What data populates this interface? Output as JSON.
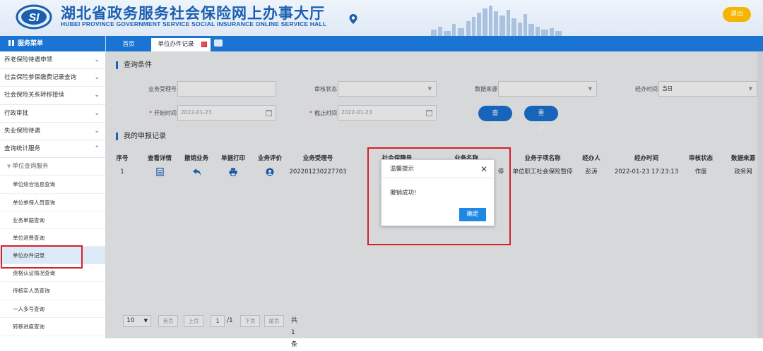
{
  "header": {
    "title_cn": "湖北省政务服务社会保险网上办事大厅",
    "title_en": "HUBEI PROVINCE GOVERNMENT SERVICE SOCIAL INSURANCE ONLINE SERVICE HALL",
    "logout": "退出"
  },
  "sidebar": {
    "heading": "服务菜单",
    "items": [
      {
        "label": "养老保险待遇申领",
        "chev": "⌄"
      },
      {
        "label": "社会保险参保缴费记录查询",
        "chev": "⌄"
      },
      {
        "label": "社会保险关系转移接续",
        "chev": "⌄"
      },
      {
        "label": "行政审批",
        "chev": "⌄"
      },
      {
        "label": "失业保险待遇",
        "chev": "⌄"
      },
      {
        "label": "查询统计服务",
        "chev": "⌃"
      }
    ],
    "sub_group": "单位查询服务",
    "leaves": [
      "单位综合信息查询",
      "单位参保人员查询",
      "业务单据查询",
      "单位退费查询",
      "单位办件记录",
      "资格认证情况查询",
      "待核实人员查询",
      "一人多号查询",
      "转移进度查询"
    ],
    "active_index": 4
  },
  "tabs": {
    "home": "首页",
    "records": "单位办件记录"
  },
  "query": {
    "section_title": "查询条件",
    "business_no_label": "业务受理号",
    "review_status_label": "审核状态",
    "data_source_label": "数据来源",
    "process_time_label": "经办时间",
    "process_time_value": "当日",
    "start_time_label": "开始时间",
    "start_time_value": "2022-01-23",
    "end_time_label": "截止时间",
    "end_time_value": "2022-01-23",
    "search_btn": "查 询",
    "reset_btn": "重 置"
  },
  "records": {
    "section_title": "我的申报记录",
    "columns": [
      "序号",
      "查看详情",
      "撤销业务",
      "单据打印",
      "业务评价",
      "业务受理号",
      "社会保障号",
      "业务名称",
      "业务子项名称",
      "经办人",
      "经办时间",
      "审核状态",
      "数据来源"
    ],
    "rows": [
      {
        "no": "1",
        "business_no": "202201230227703",
        "name_tail": "停",
        "sub_name": "单位职工社会保险暂停",
        "handler": "彭涛",
        "time": "2022-01-23 17:23:13",
        "status": "作废",
        "source": "政务网"
      }
    ]
  },
  "pager": {
    "page_size": "10",
    "first": "首页",
    "prev": "上页",
    "page": "1",
    "total_pages": "/1",
    "next": "下页",
    "last": "尾页",
    "total": "共 1条"
  },
  "modal": {
    "title": "温馨提示",
    "message": "撤销成功!",
    "ok": "确定"
  },
  "colors": {
    "primary": "#1a74d4",
    "logout": "#f5b400",
    "highlight": "#d6202a"
  }
}
